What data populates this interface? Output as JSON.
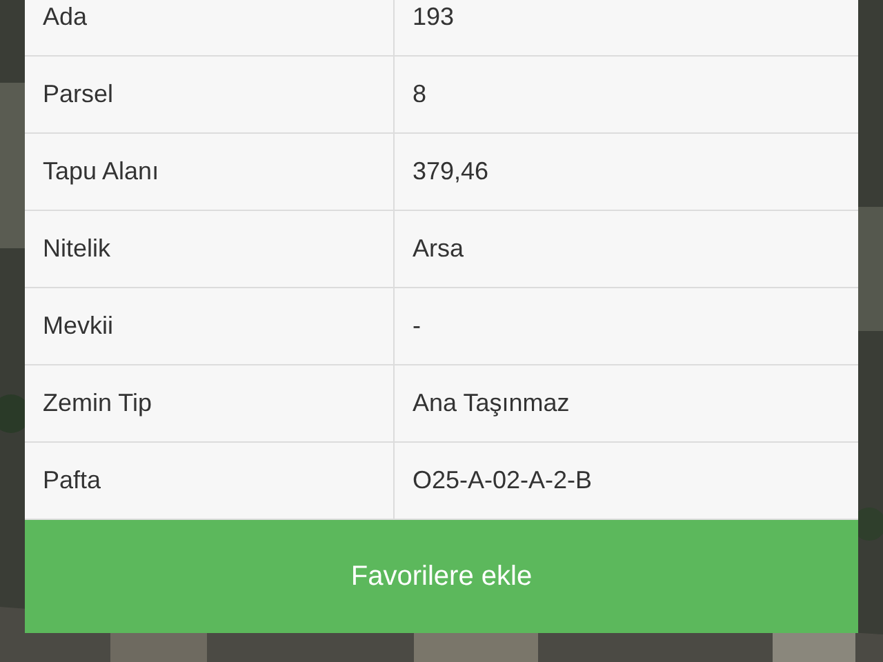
{
  "details": [
    {
      "label": "Ada",
      "value": "193"
    },
    {
      "label": "Parsel",
      "value": "8"
    },
    {
      "label": "Tapu Alanı",
      "value": "379,46"
    },
    {
      "label": "Nitelik",
      "value": "Arsa"
    },
    {
      "label": "Mevkii",
      "value": "-"
    },
    {
      "label": "Zemin Tip",
      "value": "Ana Taşınmaz"
    },
    {
      "label": "Pafta",
      "value": "O25-A-02-A-2-B"
    }
  ],
  "button": {
    "label": "Favorilere ekle"
  }
}
